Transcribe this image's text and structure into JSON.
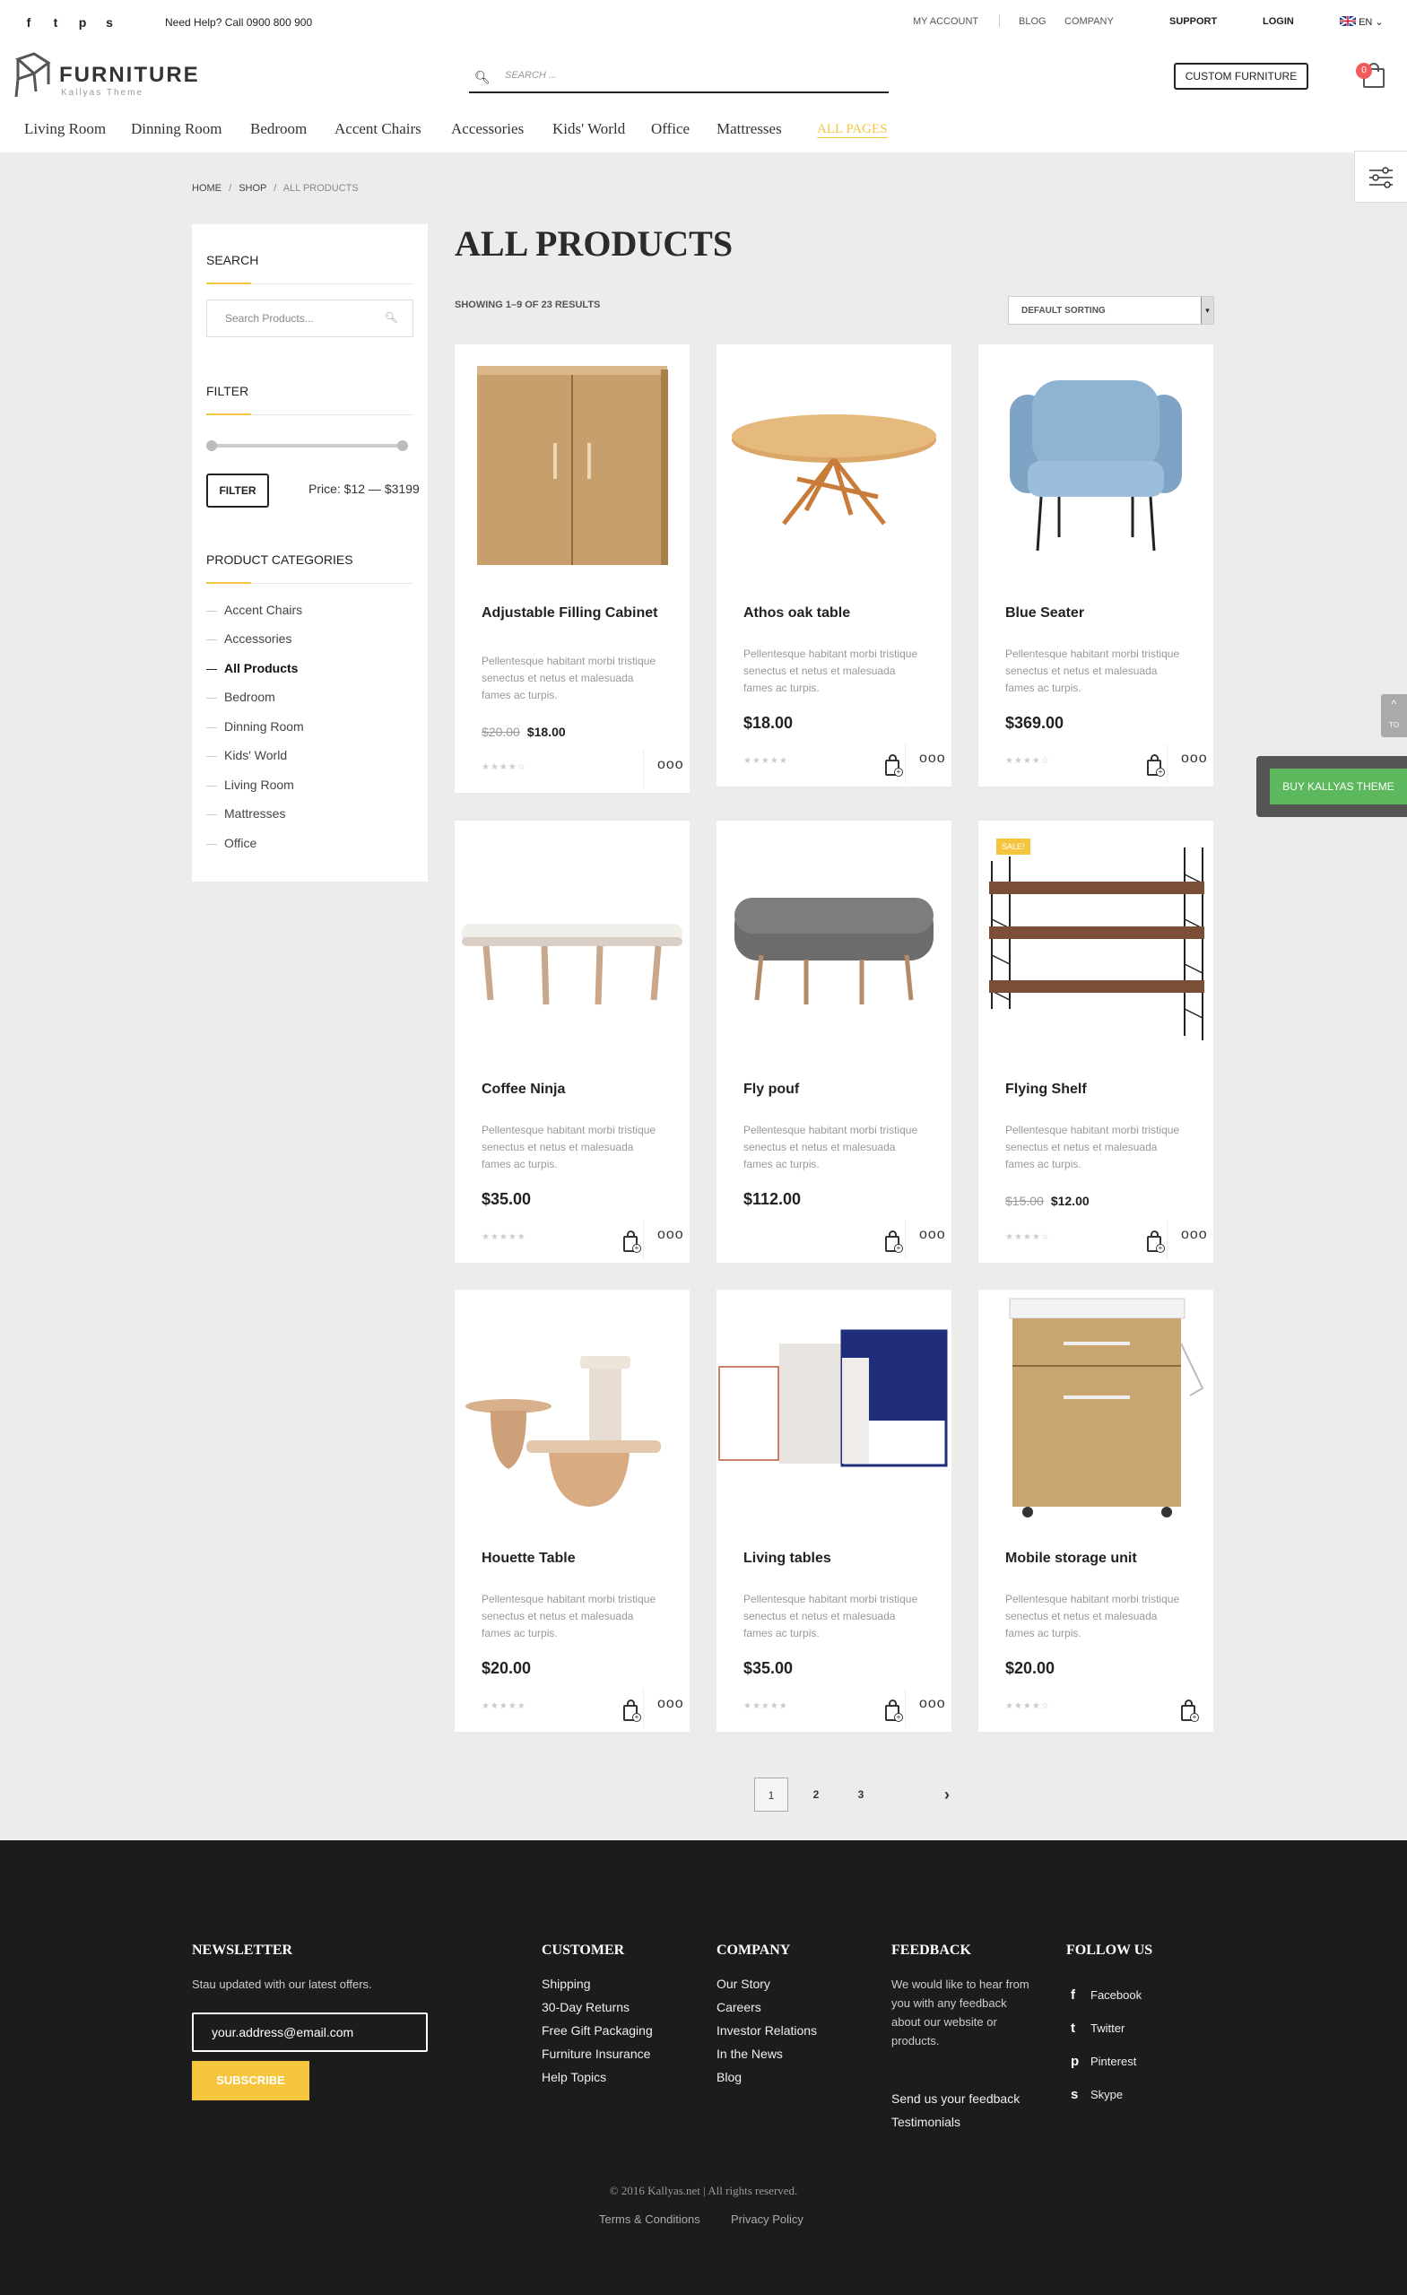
{
  "topbar": {
    "social_icons": [
      "facebook-icon",
      "twitter-icon",
      "pinterest-icon",
      "skype-icon"
    ],
    "help_text": "Need Help? Call 0900 800 900",
    "links": {
      "my_account": "MY ACCOUNT",
      "blog": "BLOG",
      "company": "COMPANY",
      "support": "SUPPORT",
      "login": "LOGIN",
      "language": "EN"
    }
  },
  "header": {
    "logo_name": "FURNITURE",
    "logo_tagline": "Kallyas Theme",
    "search_placeholder": "SEARCH ...",
    "custom_button": "CUSTOM FURNITURE",
    "cart_count": "0"
  },
  "nav": [
    "Living Room",
    "Dinning Room",
    "Bedroom",
    "Accent Chairs",
    "Accessories",
    "Kids' World",
    "Office",
    "Mattresses",
    "ALL PAGES"
  ],
  "breadcrumb": {
    "home": "HOME",
    "sep": "/",
    "shop": "SHOP",
    "current": "ALL PRODUCTS"
  },
  "sidebar": {
    "search_title": "SEARCH",
    "search_placeholder": "Search Products...",
    "filter_title": "FILTER",
    "price_min_fraction": 0.0,
    "price_max_fraction": 1.0,
    "filter_button": "FILTER",
    "price_label": "Price: $12 — $3199",
    "categories_title": "PRODUCT CATEGORIES",
    "categories": [
      "Accent Chairs",
      "Accessories",
      "All Products",
      "Bedroom",
      "Dinning Room",
      "Kids' World",
      "Living Room",
      "Mattresses",
      "Office"
    ],
    "current_category": "All Products"
  },
  "main": {
    "title": "ALL PRODUCTS",
    "showing": "SHOWING 1–9 OF 23 RESULTS",
    "sort_value": "DEFAULT SORTING"
  },
  "products": [
    {
      "title": "Adjustable Filling Cabinet",
      "desc": "Pellentesque habitant morbi tristique senectus et netus et malesuada fames ac turpis.",
      "old_price": "$20.00",
      "price": "$18.00",
      "sale": false,
      "rating": "★★★★☆"
    },
    {
      "title": "Athos oak table",
      "desc": "Pellentesque habitant morbi tristique senectus et netus et malesuada fames ac turpis.",
      "old_price": "",
      "price": "$18.00",
      "sale": false,
      "rating": "★★★★★"
    },
    {
      "title": "Blue Seater",
      "desc": "Pellentesque habitant morbi tristique senectus et netus et malesuada fames ac turpis.",
      "old_price": "",
      "price": "$369.00",
      "sale": false,
      "rating": "★★★★☆"
    },
    {
      "title": "Coffee Ninja",
      "desc": "Pellentesque habitant morbi tristique senectus et netus et malesuada fames ac turpis.",
      "old_price": "",
      "price": "$35.00",
      "sale": false,
      "rating": "★★★★★"
    },
    {
      "title": "Fly pouf",
      "desc": "Pellentesque habitant morbi tristique senectus et netus et malesuada fames ac turpis.",
      "old_price": "",
      "price": "$112.00",
      "sale": false,
      "rating": ""
    },
    {
      "title": "Flying Shelf",
      "desc": "Pellentesque habitant morbi tristique senectus et netus et malesuada fames ac turpis.",
      "old_price": "$15.00",
      "price": "$12.00",
      "sale": true,
      "sale_label": "SALE!",
      "rating": "★★★★☆"
    },
    {
      "title": "Houette Table",
      "desc": "Pellentesque habitant morbi tristique senectus et netus et malesuada fames ac turpis.",
      "old_price": "",
      "price": "$20.00",
      "sale": false,
      "rating": "★★★★★"
    },
    {
      "title": "Living tables",
      "desc": "Pellentesque habitant morbi tristique senectus et netus et malesuada fames ac turpis.",
      "old_price": "",
      "price": "$35.00",
      "sale": false,
      "rating": "★★★★★"
    },
    {
      "title": "Mobile storage unit",
      "desc": "Pellentesque habitant morbi tristique senectus et netus et malesuada fames ac turpis.",
      "old_price": "",
      "price": "$20.00",
      "sale": false,
      "rating": "★★★★☆"
    }
  ],
  "pagination": {
    "pages": [
      "1",
      "2",
      "3"
    ],
    "current": "1",
    "next": "›"
  },
  "floating": {
    "buy_button": "BUY KALLYAS THEME",
    "to_top": "TO"
  },
  "footer": {
    "newsletter": {
      "title": "NEWSLETTER",
      "text": "Stau updated with our latest offers.",
      "email_value": "your.address@email.com",
      "button": "SUBSCRIBE"
    },
    "customer": {
      "title": "CUSTOMER",
      "links": [
        "Shipping",
        "30-Day Returns",
        "Free Gift Packaging",
        "Furniture Insurance",
        "Help Topics"
      ]
    },
    "company": {
      "title": "COMPANY",
      "links": [
        "Our Story",
        "Careers",
        "Investor Relations",
        "In the News",
        "Blog"
      ]
    },
    "feedback": {
      "title": "FEEDBACK",
      "text": "We would like to hear from you with any feedback about our website or products.",
      "links": [
        "Send us your feedback",
        "Testimonials"
      ]
    },
    "follow": {
      "title": "FOLLOW US",
      "links": [
        "Facebook",
        "Twitter",
        "Pinterest",
        "Skype"
      ]
    },
    "copyright": "© 2016 Kallyas.net | All rights reserved.",
    "legal": [
      "Terms & Conditions",
      "Privacy Policy"
    ]
  }
}
